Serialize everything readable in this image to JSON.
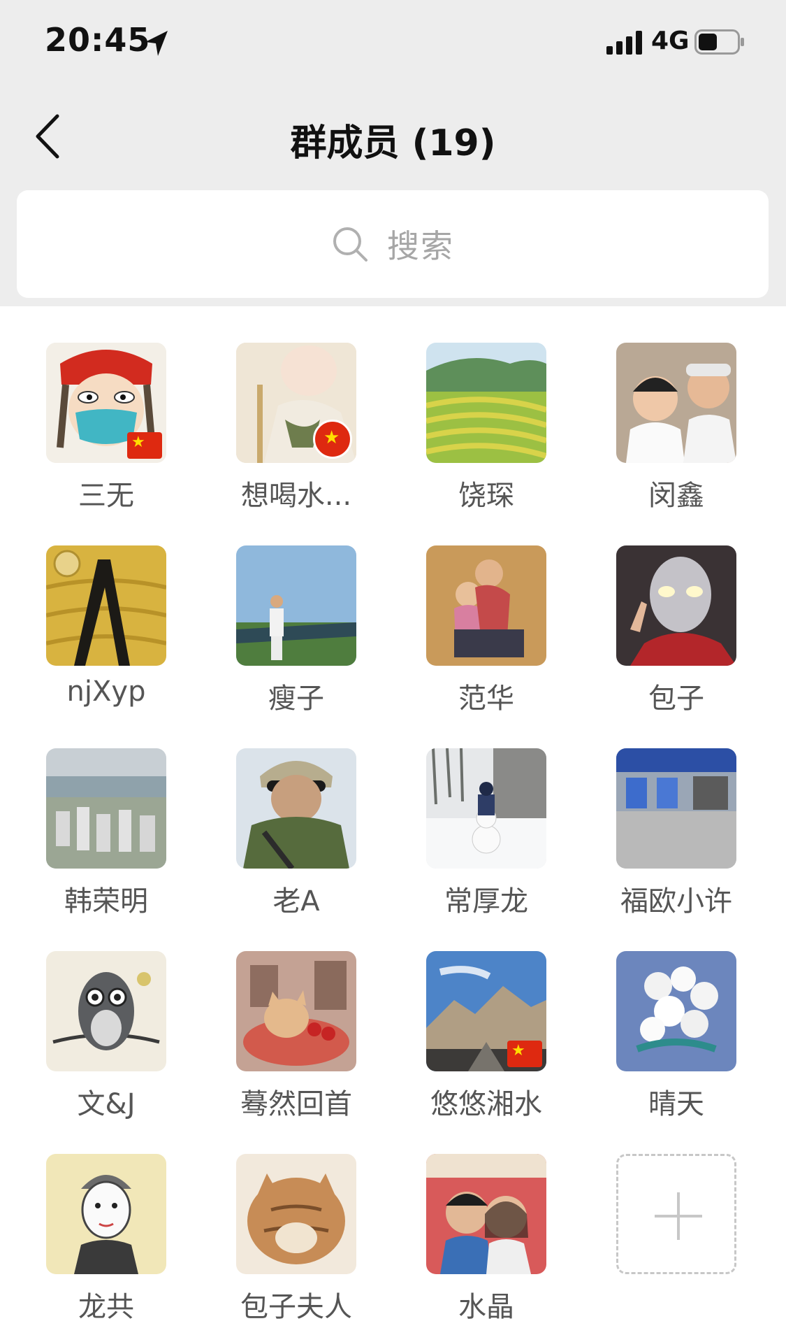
{
  "status": {
    "time": "20:45",
    "network": "4G"
  },
  "nav": {
    "title": "群成员 (19)"
  },
  "search": {
    "placeholder": "搜索"
  },
  "members": [
    {
      "name": "三无"
    },
    {
      "name": "想喝水..."
    },
    {
      "name": "饶琛"
    },
    {
      "name": "闵鑫"
    },
    {
      "name": "njXyp"
    },
    {
      "name": "瘦子"
    },
    {
      "name": "范华"
    },
    {
      "name": "包子"
    },
    {
      "name": "韩荣明"
    },
    {
      "name": "老A"
    },
    {
      "name": "常厚龙"
    },
    {
      "name": "福欧小许"
    },
    {
      "name": "文&J"
    },
    {
      "name": "蓦然回首"
    },
    {
      "name": "悠悠湘水"
    },
    {
      "name": "晴天"
    },
    {
      "name": "龙共"
    },
    {
      "name": "包子夫人"
    },
    {
      "name": "水晶"
    }
  ],
  "add_member": {
    "icon": "plus-icon"
  }
}
